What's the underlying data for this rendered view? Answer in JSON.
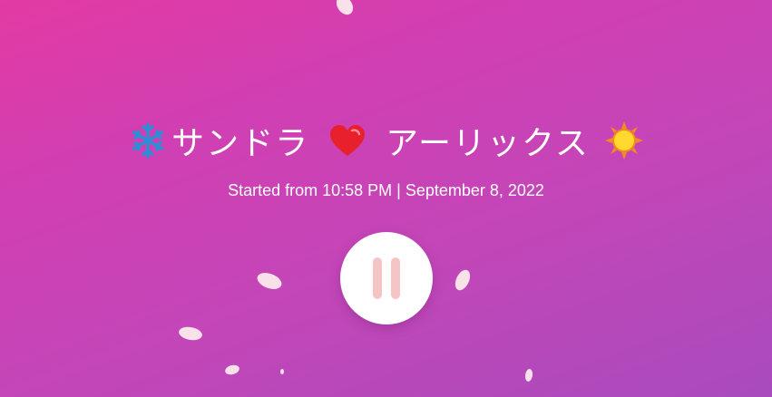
{
  "title": {
    "left_icon": "snowflake-icon",
    "left_name": "サンドラ",
    "middle_icon": "heart-icon",
    "right_name": "アーリックス",
    "right_icon": "sun-icon"
  },
  "subtitle": "Started from 10:58 PM | September 8, 2022",
  "controls": {
    "pause_icon": "pause-icon"
  },
  "decorations": {
    "petal_icon": "cherry-blossom-petal-icon"
  },
  "colors": {
    "background_start": "#e33aa3",
    "background_end": "#a94bbd",
    "text": "#ffffff",
    "pause_bars": "#f5c4c4",
    "snowflake": "#2b8fd6",
    "heart": "#e8202e",
    "sun_core": "#ffd92e",
    "sun_rays": "#f58c1c",
    "petal": "#f9e1ea"
  }
}
